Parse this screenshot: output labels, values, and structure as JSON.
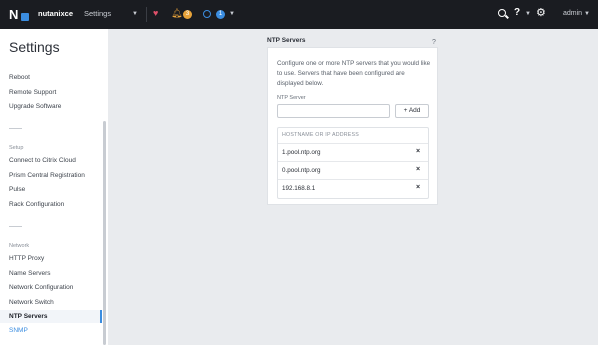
{
  "topbar": {
    "cluster_name": "nutanixce",
    "nav_label": "Settings",
    "alerts_count": "3",
    "tasks_count": "1",
    "user": "admin",
    "help_glyph": "?"
  },
  "sidebar": {
    "title": "Settings",
    "items_top": [
      "Reboot",
      "Remote Support",
      "Upgrade Software"
    ],
    "setup_header": "Setup",
    "setup_items": [
      "Connect to Citrix Cloud",
      "Prism Central Registration",
      "Pulse",
      "Rack Configuration"
    ],
    "network_header": "Network",
    "network_items": [
      "HTTP Proxy",
      "Name Servers",
      "Network Configuration",
      "Network Switch",
      "NTP Servers",
      "SNMP"
    ]
  },
  "ntp": {
    "title": "NTP Servers",
    "help": "?",
    "description": "Configure one or more NTP servers that you would like to use. Servers that have been configured are displayed below.",
    "field_label": "NTP Server",
    "input_value": "",
    "add_label": "+ Add",
    "table_header": "HOSTNAME OR IP ADDRESS",
    "servers": [
      "1.pool.ntp.org",
      "0.pool.ntp.org",
      "192.168.8.1"
    ],
    "remove_glyph": "×"
  },
  "colors": {
    "topbar": "#1a1c21",
    "accent": "#3b8de0",
    "alert": "#e8a33a",
    "health": "#e0506a"
  }
}
